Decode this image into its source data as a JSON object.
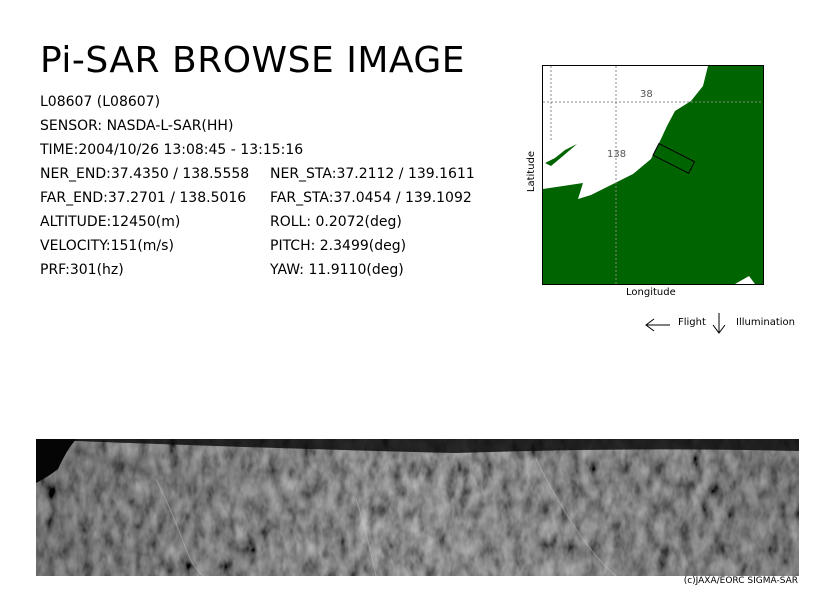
{
  "header": {
    "title": "Pi-SAR BROWSE IMAGE"
  },
  "info": {
    "scene_id": "L08607 (L08607)",
    "sensor": "SENSOR: NASDA-L-SAR(HH)",
    "time": "TIME:2004/10/26  13:08:45 - 13:15:16",
    "ner_end": "NER_END:37.4350 / 138.5558",
    "far_end": "FAR_END:37.2701 / 138.5016",
    "altitude": "ALTITUDE:12450(m)",
    "velocity": "VELOCITY:151(m/s)",
    "prf": "PRF:301(hz)",
    "ner_sta": "NER_STA:37.2112 / 139.1611",
    "far_sta": "FAR_STA:37.0454 / 139.1092",
    "roll": "ROLL: 0.2072(deg)",
    "pitch": "PITCH:  2.3499(deg)",
    "yaw": "YAW:  11.9110(deg)"
  },
  "map": {
    "lat_grid_label": "38",
    "lon_grid_label": "138",
    "y_axis_label": "Latitude",
    "x_axis_label": "Longitude",
    "land_color": "#006400",
    "sea_color": "#ffffff"
  },
  "legend": {
    "flight_label": "Flight",
    "illumination_label": "Illumination",
    "flight_icon": "arrow-left-icon",
    "illumination_icon": "arrow-down-icon"
  },
  "footer": {
    "copyright": "(c)JAXA/EORC SIGMA-SAR"
  }
}
